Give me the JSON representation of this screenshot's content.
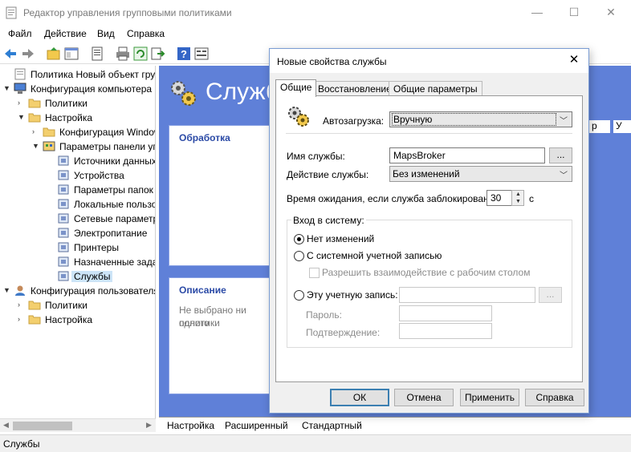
{
  "window": {
    "title": "Редактор управления групповыми политиками",
    "controls": {
      "minimize": "—",
      "maximize": "☐",
      "close": "✕"
    }
  },
  "menu": [
    "Файл",
    "Действие",
    "Вид",
    "Справка"
  ],
  "toolbar": {
    "icons": [
      "back-icon",
      "forward-icon",
      "up-folder-icon",
      "show-hide-tree-icon",
      "properties-icon",
      "print-icon",
      "refresh-icon",
      "export-icon",
      "help-icon",
      "console-icon"
    ]
  },
  "tree": {
    "items": [
      {
        "label": "Политика Новый объект групп",
        "level": 0,
        "icon": "policy-icon",
        "expander": ""
      },
      {
        "label": "Конфигурация компьютера",
        "level": 0,
        "icon": "computer-icon",
        "expander": "▼"
      },
      {
        "label": "Политики",
        "level": 1,
        "icon": "folder-icon",
        "expander": "›"
      },
      {
        "label": "Настройка",
        "level": 1,
        "icon": "folder-icon",
        "expander": "▼"
      },
      {
        "label": "Конфигурация Windows",
        "level": 2,
        "icon": "folder-icon",
        "expander": "›"
      },
      {
        "label": "Параметры панели управления",
        "level": 2,
        "icon": "control-panel-icon",
        "expander": "▼"
      },
      {
        "label": "Источники данных",
        "level": 3,
        "icon": "data-sources-icon",
        "expander": ""
      },
      {
        "label": "Устройства",
        "level": 3,
        "icon": "devices-icon",
        "expander": ""
      },
      {
        "label": "Параметры папок",
        "level": 3,
        "icon": "folder-options-icon",
        "expander": ""
      },
      {
        "label": "Локальные пользователи",
        "level": 3,
        "icon": "local-users-icon",
        "expander": ""
      },
      {
        "label": "Сетевые параметры",
        "level": 3,
        "icon": "network-icon",
        "expander": ""
      },
      {
        "label": "Электропитание",
        "level": 3,
        "icon": "power-icon",
        "expander": ""
      },
      {
        "label": "Принтеры",
        "level": 3,
        "icon": "printers-icon",
        "expander": ""
      },
      {
        "label": "Назначенные задания",
        "level": 3,
        "icon": "scheduled-tasks-icon",
        "expander": ""
      },
      {
        "label": "Службы",
        "level": 3,
        "icon": "services-icon",
        "expander": "",
        "selected": true
      },
      {
        "label": "Конфигурация пользователя",
        "level": 0,
        "icon": "user-icon",
        "expander": "▼"
      },
      {
        "label": "Политики",
        "level": 1,
        "icon": "folder-icon",
        "expander": "›"
      },
      {
        "label": "Настройка",
        "level": 1,
        "icon": "folder-icon",
        "expander": "›"
      }
    ]
  },
  "right_pane": {
    "heading": "Службы",
    "processing_title": "Обработка",
    "description_title": "Описание",
    "description_text": [
      "Не выбрано ни одного",
      "политики"
    ],
    "column_headers": [
      "р",
      "У"
    ],
    "view_tabs": [
      "Настройка",
      "Расширенный",
      "Стандартный"
    ]
  },
  "status": "Службы",
  "dialog": {
    "title": "Новые свойства службы",
    "tabs": [
      "Общие",
      "Восстановление",
      "Общие параметры"
    ],
    "startup_label": "Автозагрузка:",
    "startup_value": "Вручную",
    "service_name_label": "Имя службы:",
    "service_name_value": "MapsBroker",
    "browse_label": "...",
    "action_label": "Действие службы:",
    "action_value": "Без изменений",
    "timeout_label": "Время ожидания, если служба заблокирована:",
    "timeout_value": "30",
    "timeout_unit": "с",
    "logon_group": "Вход в систему:",
    "radio_no_change": "Нет изменений",
    "radio_system": "С системной учетной записью",
    "checkbox_desktop": "Разрешить взаимодействие с рабочим столом",
    "radio_account": "Эту учетную запись:",
    "password_label": "Пароль:",
    "confirm_label": "Подтверждение:",
    "buttons": {
      "ok": "ОК",
      "cancel": "Отмена",
      "apply": "Применить",
      "help": "Справка"
    }
  }
}
